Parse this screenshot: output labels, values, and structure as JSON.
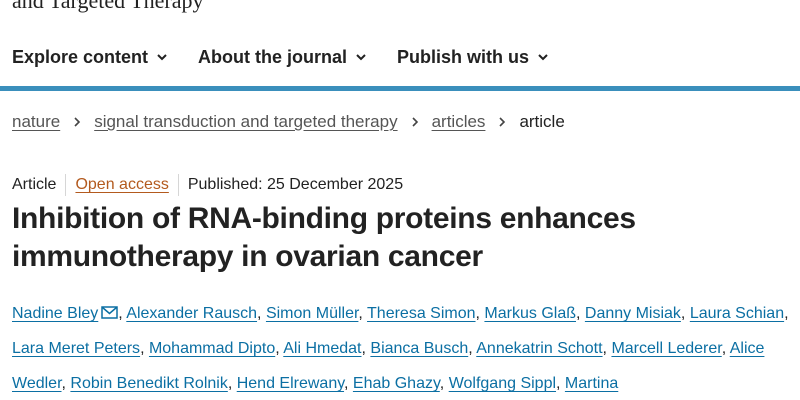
{
  "journal": {
    "title_fragment": "and Targeted Therapy"
  },
  "nav": {
    "items": [
      {
        "label": "Explore content",
        "icon": "chevron-down-icon"
      },
      {
        "label": "About the journal",
        "icon": "chevron-down-icon"
      },
      {
        "label": "Publish with us",
        "icon": "chevron-down-icon"
      }
    ]
  },
  "colors": {
    "accent_rule": "#3a8fbc",
    "author_link": "#0b6fa3",
    "open_access": "#b35a1e"
  },
  "breadcrumb": {
    "items": [
      {
        "label": "nature"
      },
      {
        "label": "signal transduction and targeted therapy"
      },
      {
        "label": "articles"
      },
      {
        "label": "article"
      }
    ]
  },
  "article": {
    "type": "Article",
    "access": "Open access",
    "published": "Published: 25 December 2025",
    "title_line1": "Inhibition of RNA-binding proteins enhances",
    "title_line2": "immunotherapy in ovarian cancer"
  },
  "authors": [
    "Nadine Bley",
    "Alexander Rausch",
    "Simon Müller",
    "Theresa Simon",
    "Markus Glaß",
    "Danny Misiak",
    "Laura Schian",
    "Lara Meret Peters",
    "Mohammad Dipto",
    "Ali Hmedat",
    "Bianca Busch",
    "Annekatrin Schott",
    "Marcell Lederer",
    "Alice Wedler",
    "Robin Benedikt Rolnik",
    "Hend Elrewany",
    "Ehab Ghazy",
    "Wolfgang Sippl",
    "Martina"
  ],
  "corresponding_icon": "mail-icon"
}
